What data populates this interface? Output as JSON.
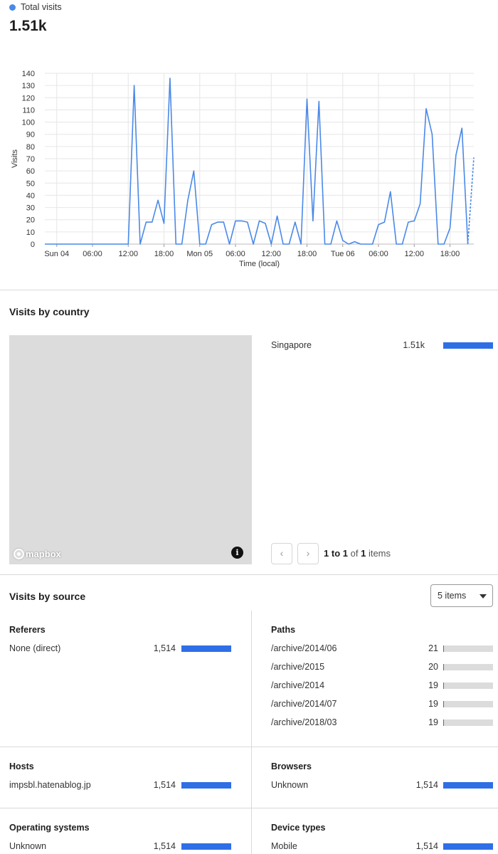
{
  "total_visits": {
    "legend_label": "Total visits",
    "value": "1.51k",
    "series_color": "#4a89e8"
  },
  "chart_data": {
    "type": "line",
    "ylabel": "Visits",
    "xlabel": "Time (local)",
    "ylim": [
      0,
      140
    ],
    "yticks": [
      0,
      10,
      20,
      30,
      40,
      50,
      60,
      70,
      80,
      90,
      100,
      110,
      120,
      130,
      140
    ],
    "xlim_hours": [
      -2,
      64
    ],
    "xticks": [
      {
        "h": 0,
        "label": "Sun 04"
      },
      {
        "h": 6,
        "label": "06:00"
      },
      {
        "h": 12,
        "label": "12:00"
      },
      {
        "h": 18,
        "label": "18:00"
      },
      {
        "h": 24,
        "label": "Mon 05"
      },
      {
        "h": 30,
        "label": "06:00"
      },
      {
        "h": 36,
        "label": "12:00"
      },
      {
        "h": 42,
        "label": "18:00"
      },
      {
        "h": 48,
        "label": "Tue 06"
      },
      {
        "h": 54,
        "label": "06:00"
      },
      {
        "h": 60,
        "label": "12:00"
      },
      {
        "h": 66,
        "label": "18:00"
      }
    ],
    "grid": true,
    "series": [
      {
        "color": "#4a89e8",
        "x": [
          -2,
          -1,
          0,
          1,
          2,
          3,
          4,
          5,
          6,
          7,
          8,
          9,
          10,
          11,
          12,
          13,
          14,
          15,
          16,
          17,
          18,
          19,
          20,
          21,
          22,
          23,
          24,
          25,
          26,
          27,
          28,
          29,
          30,
          31,
          32,
          33,
          34,
          35,
          36,
          37,
          38,
          39,
          40,
          41,
          42,
          43,
          44,
          45,
          46,
          47,
          48,
          49,
          50,
          51,
          52,
          53,
          54,
          55,
          56,
          57,
          58,
          59,
          60,
          61,
          62,
          63,
          64,
          65,
          66,
          67,
          68,
          69,
          70
        ],
        "y": [
          0,
          0,
          0,
          0,
          0,
          0,
          0,
          0,
          0,
          0,
          0,
          0,
          0,
          0,
          0,
          130,
          0,
          18,
          18,
          36,
          17,
          136,
          0,
          0,
          36,
          60,
          0,
          0,
          16,
          18,
          18,
          0,
          19,
          19,
          18,
          0,
          19,
          17,
          0,
          23,
          0,
          0,
          18,
          0,
          119,
          19,
          117,
          0,
          0,
          19,
          3,
          0,
          2,
          0,
          0,
          0,
          16,
          18,
          43,
          0,
          0,
          18,
          19,
          33,
          111,
          90,
          0,
          0,
          13,
          73,
          95,
          0,
          71
        ],
        "dashed_from_x": 69
      }
    ]
  },
  "country": {
    "title": "Visits by country",
    "map_attribution": "mapbox",
    "info_glyph": "i",
    "rows": [
      {
        "label": "Singapore",
        "value": "1.51k",
        "fraction": 1.0
      }
    ],
    "pagination": {
      "prev": "‹",
      "next": "›",
      "from": "1",
      "to_word": "to",
      "to": "1",
      "of_word": "of",
      "total": "1",
      "items_word": "items"
    }
  },
  "source": {
    "title": "Visits by source",
    "select_value": "5 items",
    "referers": {
      "title": "Referers",
      "rows": [
        {
          "label": "None (direct)",
          "value": "1,514",
          "fraction": 1.0
        }
      ]
    },
    "paths": {
      "title": "Paths",
      "rows": [
        {
          "label": "/archive/2014/06",
          "value": "21",
          "fraction": 0.014
        },
        {
          "label": "/archive/2015",
          "value": "20",
          "fraction": 0.013
        },
        {
          "label": "/archive/2014",
          "value": "19",
          "fraction": 0.013
        },
        {
          "label": "/archive/2014/07",
          "value": "19",
          "fraction": 0.013
        },
        {
          "label": "/archive/2018/03",
          "value": "19",
          "fraction": 0.013
        }
      ]
    },
    "hosts": {
      "title": "Hosts",
      "rows": [
        {
          "label": "impsbl.hatenablog.jp",
          "value": "1,514",
          "fraction": 1.0
        }
      ]
    },
    "browsers": {
      "title": "Browsers",
      "rows": [
        {
          "label": "Unknown",
          "value": "1,514",
          "fraction": 1.0
        }
      ]
    },
    "os": {
      "title": "Operating systems",
      "rows": [
        {
          "label": "Unknown",
          "value": "1,514",
          "fraction": 1.0
        }
      ]
    },
    "devices": {
      "title": "Device types",
      "rows": [
        {
          "label": "Mobile",
          "value": "1,514",
          "fraction": 1.0
        }
      ]
    }
  }
}
